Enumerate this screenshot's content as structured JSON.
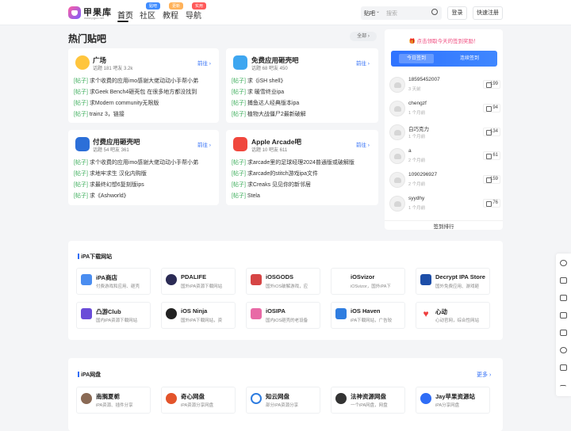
{
  "header": {
    "logo_text": "甲果库",
    "logo_sub": "www.pguo.net",
    "nav": [
      {
        "label": "首页"
      },
      {
        "label": "社区",
        "badge": "贴吧",
        "badge_color": "#3f8cff"
      },
      {
        "label": "教程",
        "badge": "更新",
        "badge_color": "#ffb25a"
      },
      {
        "label": "导航",
        "badge": "实用",
        "badge_color": "#ff5a5a"
      }
    ],
    "search_select": "贴吧",
    "search_placeholder": "搜索",
    "login": "登录",
    "register": "快速注册"
  },
  "forums": {
    "title": "热门贴吧",
    "all_label": "全部",
    "items": [
      {
        "name": "广场",
        "stats": "话题 181   吧友 3.2k",
        "go": "前往",
        "icon": "plaza-icon",
        "color": "#ffc53d",
        "posts": [
          [
            "[帖子]",
            "求个收费的应用imo感谢大佬动动小手帮小弟"
          ],
          [
            "[帖子]",
            "求Geek Bench4砸壳包 在很多地方都没找到"
          ],
          [
            "[帖子]",
            "求Modern community无限版"
          ],
          [
            "[帖子]",
            "trainz 3，链接"
          ]
        ]
      },
      {
        "name": "免费应用砸壳吧",
        "stats": "话题 68   吧友 450",
        "go": "前往",
        "icon": "free-app-icon",
        "color": "#3ea6f0",
        "posts": [
          [
            "[帖子]",
            "求《iSH shell》"
          ],
          [
            "[帖子]",
            "求 暖雪终业ipa"
          ],
          [
            "[帖子]",
            "捕鱼达人经典版本ipa"
          ],
          [
            "[帖子]",
            "植物大战僵尸2最新破解"
          ]
        ]
      },
      {
        "name": "付费应用砸壳吧",
        "stats": "话题 54   吧友 361",
        "go": "前往",
        "icon": "paid-app-icon",
        "color": "#2c6fd8",
        "posts": [
          [
            "[帖子]",
            "求个收费的应用imo感谢大佬动动小手帮小弟"
          ],
          [
            "[帖子]",
            "求地牢求生 汉化内购版"
          ],
          [
            "[帖子]",
            "求最终幻想6复刻版ips"
          ],
          [
            "[帖子]",
            "求《Ashworld》"
          ]
        ]
      },
      {
        "name": "Apple Arcade吧",
        "stats": "话题 10   吧友 611",
        "go": "前往",
        "icon": "arcade-icon",
        "color": "#f0473d",
        "posts": [
          [
            "[帖子]",
            "求arcade里的足球经理2024普通版或破解版"
          ],
          [
            "[帖子]",
            "求arcade的stitch游戏ipa文件"
          ],
          [
            "[帖子]",
            "求Creaks 见见你的新邻居"
          ],
          [
            "[帖子]",
            "Stela"
          ]
        ]
      }
    ]
  },
  "signin": {
    "tip": "点击领取今天的签到奖励！",
    "today": "今日签到",
    "streak": "连续签到",
    "users": [
      {
        "name": "18595452007",
        "time": "3 天前",
        "count": "199"
      },
      {
        "name": "chengzf",
        "time": "1 个月前",
        "count": "94"
      },
      {
        "name": "白巧克力",
        "time": "1 个月前",
        "count": "134"
      },
      {
        "name": "a",
        "time": "2 个月前",
        "count": "61"
      },
      {
        "name": "1090296927",
        "time": "2 个月前",
        "count": "159"
      },
      {
        "name": "syydhy",
        "time": "1 个月前",
        "count": "76"
      }
    ],
    "footer": "签到排行"
  },
  "ipa_sites": {
    "title": "iPA下载网站",
    "items": [
      {
        "name": "iPA商店",
        "desc": "付费游戏和应用、砸壳",
        "icon": "ipa-store-icon",
        "color": "#4a8df0"
      },
      {
        "name": "PDALIFE",
        "desc": "国外iPA资源下载网站",
        "icon": "pdalife-icon",
        "color": "#2b2b55"
      },
      {
        "name": "iOSGODS",
        "desc": "国外iOS破解游戏，应",
        "icon": "iosgods-icon",
        "color": "#d64545"
      },
      {
        "name": "iOSvizor",
        "desc": "iOSvizor，国外iPA下",
        "icon": "apple-icon",
        "color": "#222222"
      },
      {
        "name": "Decrypt IPA Store",
        "desc": "国外免费应用、游戏砸",
        "icon": "decrypt-icon",
        "color": "#1d4ea8"
      },
      {
        "name": "凸游Club",
        "desc": "国内iPA资源下载网站",
        "icon": "tuyou-icon",
        "color": "#6a4cd8"
      },
      {
        "name": "iOS Ninja",
        "desc": "国外iPA下载网站，资",
        "icon": "ninja-icon",
        "color": "#222222"
      },
      {
        "name": "iOSIPA",
        "desc": "国内iOS砸壳的老设备",
        "icon": "iosipa-icon",
        "color": "#e86aa6"
      },
      {
        "name": "iOS Haven",
        "desc": "iPA下载网站，广告较",
        "icon": "haven-icon",
        "color": "#2f7de0"
      },
      {
        "name": "心动",
        "desc": "心动官网，综合性网站",
        "icon": "heart-icon",
        "color": "#ef3f3f"
      }
    ]
  },
  "ipa_disks": {
    "title": "iPA网盘",
    "more": "更多",
    "items": [
      {
        "name": "南搁夏栀",
        "desc": "iPA资源、插件分享",
        "icon": "avatar-icon",
        "color": "#8a6a55"
      },
      {
        "name": "奇心网盘",
        "desc": "iPA资源分享网盘",
        "icon": "qixin-icon",
        "color": "#e3542b"
      },
      {
        "name": "知云网盘",
        "desc": "部分iPA资源分享",
        "icon": "zhiyun-icon",
        "color": "#2f7de0"
      },
      {
        "name": "法神资源网盘",
        "desc": "一个iPA网盘，网盘",
        "icon": "fashen-icon",
        "color": "#333333"
      },
      {
        "name": "Jay苹果资源站",
        "desc": "iPA分享网盘",
        "icon": "jay-icon",
        "color": "#2f6df6"
      }
    ]
  }
}
